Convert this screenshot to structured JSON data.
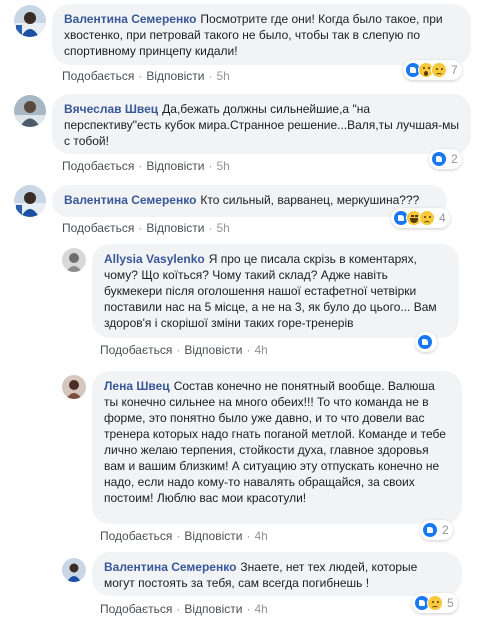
{
  "ui": {
    "like_label": "Подобається",
    "reply_label": "Відповісти",
    "separator": "·"
  },
  "comments": [
    {
      "author": "Валентина Семеренко",
      "text": "Посмотрите где они! Когда было такое, при хвостенко, при петровай такого не было, чтобы так в слепую по спортивному принцепу кидали!",
      "time": "5h",
      "reactions": [
        "like",
        "wow",
        "sad"
      ],
      "reaction_count": "7"
    },
    {
      "author": "Вячеслав Швец",
      "text": "Да,бежать должны сильнейшие,а \"на перспективу\"есть кубок мира.Странное решение...Валя,ты лучшая-мы с тобой!",
      "time": "5h",
      "reactions": [
        "like"
      ],
      "reaction_count": "2"
    },
    {
      "author": "Валентина Семеренко",
      "text": "Кто сильный, варванец, меркушина???",
      "time": "5h",
      "reactions": [
        "like",
        "haha",
        "sad"
      ],
      "reaction_count": "4"
    },
    {
      "author": "Allysia Vasylenko",
      "text": "Я про це писала скрізь в коментарях, чому? Що коїться? Чому такий склад? Адже навіть букмекери після оголошення нашої естафетної четвірки поставили нас на 5 місце, а не на 3, як було до цього... Вам здоров'я і скорішої зміни таких горе-тренерів",
      "time": "4h",
      "reactions": [
        "like"
      ],
      "reaction_count": ""
    },
    {
      "author": "Лена Швец",
      "text": "Состав конечно не понятный вообще. Валюша ты конечно сильнее на много обеих!!! То что команда не в форме, это понятно было уже давно, и то что довели вас тренера которых надо гнать поганой метлой. Команде и тебе лично желаю терпения, стойкости духа, главное здоровья вам и вашим близким! А ситуацию эту отпускать конечно не надо, если надо кому-то навалять обращайся, за своих постоим! Люблю вас мои красотули!",
      "time": "4h",
      "reactions": [
        "like"
      ],
      "reaction_count": "2"
    },
    {
      "author": "Валентина Семеренко",
      "text": "Знаете, нет тех людей, которые могут постоять за тебя, сам всегда погибнешь !",
      "time": "4h",
      "reactions": [
        "like",
        "sad"
      ],
      "reaction_count": "5"
    }
  ],
  "colors": {
    "author": "#385898",
    "bubble": "#f2f3f5",
    "meta": "#90949c",
    "like": "#1877f2"
  }
}
